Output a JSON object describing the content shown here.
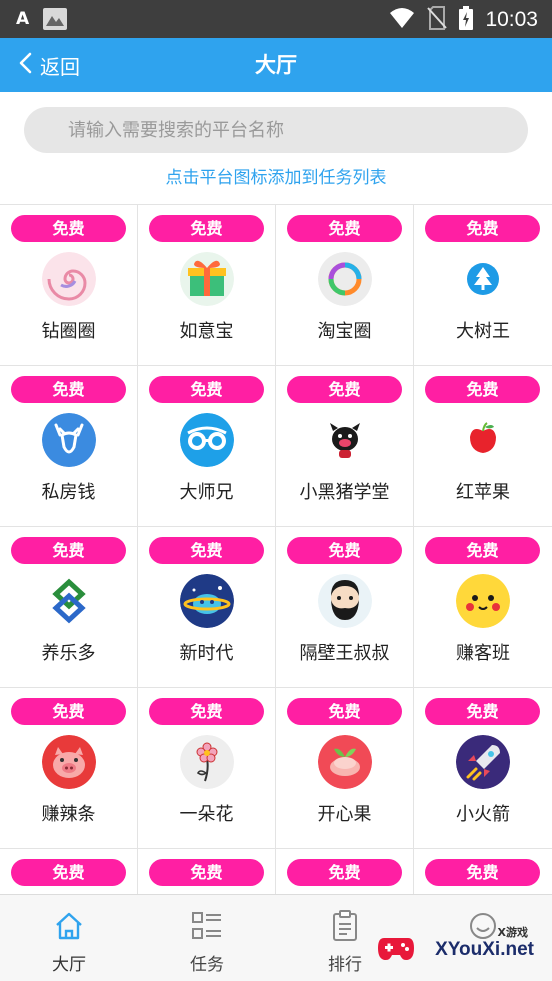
{
  "status_bar": {
    "time": "10:03",
    "left_glyph": "A"
  },
  "header": {
    "back_label": "返回",
    "title": "大厅"
  },
  "search": {
    "placeholder": "请输入需要搜索的平台名称",
    "value": ""
  },
  "hint": "点击平台图标添加到任务列表",
  "platforms": [
    {
      "badge": "免费",
      "name": "钻圈圈",
      "icon": "swirl-icon"
    },
    {
      "badge": "免费",
      "name": "如意宝",
      "icon": "gift-icon"
    },
    {
      "badge": "免费",
      "name": "淘宝圈",
      "icon": "ring-icon"
    },
    {
      "badge": "免费",
      "name": "大树王",
      "icon": "tree-icon"
    },
    {
      "badge": "免费",
      "name": "私房钱",
      "icon": "deer-icon"
    },
    {
      "badge": "免费",
      "name": "大师兄",
      "icon": "glasses-icon"
    },
    {
      "badge": "免费",
      "name": "小黑猪学堂",
      "icon": "black-pig-icon"
    },
    {
      "badge": "免费",
      "name": "红苹果",
      "icon": "apple-icon"
    },
    {
      "badge": "免费",
      "name": "养乐多",
      "icon": "knot-icon"
    },
    {
      "badge": "免费",
      "name": "新时代",
      "icon": "planet-icon"
    },
    {
      "badge": "免费",
      "name": "隔壁王叔叔",
      "icon": "bearded-man-icon"
    },
    {
      "badge": "免费",
      "name": "赚客班",
      "icon": "pikachu-icon"
    },
    {
      "badge": "免费",
      "name": "赚辣条",
      "icon": "pig-icon"
    },
    {
      "badge": "免费",
      "name": "一朵花",
      "icon": "flower-icon"
    },
    {
      "badge": "免费",
      "name": "开心果",
      "icon": "pistachio-icon"
    },
    {
      "badge": "免费",
      "name": "小火箭",
      "icon": "rocket-icon"
    },
    {
      "badge": "免费",
      "name": "",
      "icon": ""
    },
    {
      "badge": "免费",
      "name": "",
      "icon": ""
    },
    {
      "badge": "免费",
      "name": "",
      "icon": ""
    },
    {
      "badge": "免费",
      "name": "",
      "icon": ""
    }
  ],
  "tabs": [
    {
      "label": "大厅",
      "icon": "home-icon",
      "active": true
    },
    {
      "label": "任务",
      "icon": "task-list-icon",
      "active": false
    },
    {
      "label": "排行",
      "icon": "clipboard-icon",
      "active": false
    },
    {
      "label": "",
      "icon": "smile-icon",
      "active": false
    }
  ],
  "watermark": {
    "small": "X游戏",
    "big": "XYouXi.net"
  },
  "colors": {
    "header": "#2fa3ee",
    "badge": "#ff1fa3",
    "hint": "#2fa3ee"
  }
}
